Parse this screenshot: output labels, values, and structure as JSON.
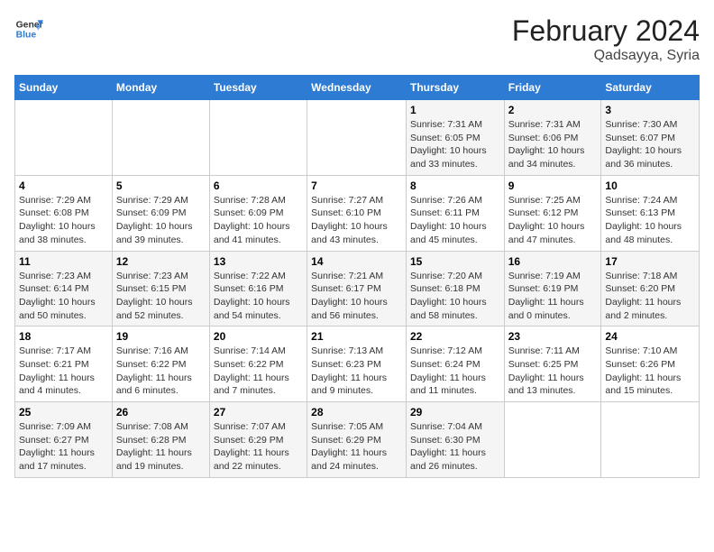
{
  "header": {
    "logo_line1": "General",
    "logo_line2": "Blue",
    "month": "February 2024",
    "location": "Qadsayya, Syria"
  },
  "weekdays": [
    "Sunday",
    "Monday",
    "Tuesday",
    "Wednesday",
    "Thursday",
    "Friday",
    "Saturday"
  ],
  "weeks": [
    [
      {
        "day": "",
        "info": ""
      },
      {
        "day": "",
        "info": ""
      },
      {
        "day": "",
        "info": ""
      },
      {
        "day": "",
        "info": ""
      },
      {
        "day": "1",
        "info": "Sunrise: 7:31 AM\nSunset: 6:05 PM\nDaylight: 10 hours and 33 minutes."
      },
      {
        "day": "2",
        "info": "Sunrise: 7:31 AM\nSunset: 6:06 PM\nDaylight: 10 hours and 34 minutes."
      },
      {
        "day": "3",
        "info": "Sunrise: 7:30 AM\nSunset: 6:07 PM\nDaylight: 10 hours and 36 minutes."
      }
    ],
    [
      {
        "day": "4",
        "info": "Sunrise: 7:29 AM\nSunset: 6:08 PM\nDaylight: 10 hours and 38 minutes."
      },
      {
        "day": "5",
        "info": "Sunrise: 7:29 AM\nSunset: 6:09 PM\nDaylight: 10 hours and 39 minutes."
      },
      {
        "day": "6",
        "info": "Sunrise: 7:28 AM\nSunset: 6:09 PM\nDaylight: 10 hours and 41 minutes."
      },
      {
        "day": "7",
        "info": "Sunrise: 7:27 AM\nSunset: 6:10 PM\nDaylight: 10 hours and 43 minutes."
      },
      {
        "day": "8",
        "info": "Sunrise: 7:26 AM\nSunset: 6:11 PM\nDaylight: 10 hours and 45 minutes."
      },
      {
        "day": "9",
        "info": "Sunrise: 7:25 AM\nSunset: 6:12 PM\nDaylight: 10 hours and 47 minutes."
      },
      {
        "day": "10",
        "info": "Sunrise: 7:24 AM\nSunset: 6:13 PM\nDaylight: 10 hours and 48 minutes."
      }
    ],
    [
      {
        "day": "11",
        "info": "Sunrise: 7:23 AM\nSunset: 6:14 PM\nDaylight: 10 hours and 50 minutes."
      },
      {
        "day": "12",
        "info": "Sunrise: 7:23 AM\nSunset: 6:15 PM\nDaylight: 10 hours and 52 minutes."
      },
      {
        "day": "13",
        "info": "Sunrise: 7:22 AM\nSunset: 6:16 PM\nDaylight: 10 hours and 54 minutes."
      },
      {
        "day": "14",
        "info": "Sunrise: 7:21 AM\nSunset: 6:17 PM\nDaylight: 10 hours and 56 minutes."
      },
      {
        "day": "15",
        "info": "Sunrise: 7:20 AM\nSunset: 6:18 PM\nDaylight: 10 hours and 58 minutes."
      },
      {
        "day": "16",
        "info": "Sunrise: 7:19 AM\nSunset: 6:19 PM\nDaylight: 11 hours and 0 minutes."
      },
      {
        "day": "17",
        "info": "Sunrise: 7:18 AM\nSunset: 6:20 PM\nDaylight: 11 hours and 2 minutes."
      }
    ],
    [
      {
        "day": "18",
        "info": "Sunrise: 7:17 AM\nSunset: 6:21 PM\nDaylight: 11 hours and 4 minutes."
      },
      {
        "day": "19",
        "info": "Sunrise: 7:16 AM\nSunset: 6:22 PM\nDaylight: 11 hours and 6 minutes."
      },
      {
        "day": "20",
        "info": "Sunrise: 7:14 AM\nSunset: 6:22 PM\nDaylight: 11 hours and 7 minutes."
      },
      {
        "day": "21",
        "info": "Sunrise: 7:13 AM\nSunset: 6:23 PM\nDaylight: 11 hours and 9 minutes."
      },
      {
        "day": "22",
        "info": "Sunrise: 7:12 AM\nSunset: 6:24 PM\nDaylight: 11 hours and 11 minutes."
      },
      {
        "day": "23",
        "info": "Sunrise: 7:11 AM\nSunset: 6:25 PM\nDaylight: 11 hours and 13 minutes."
      },
      {
        "day": "24",
        "info": "Sunrise: 7:10 AM\nSunset: 6:26 PM\nDaylight: 11 hours and 15 minutes."
      }
    ],
    [
      {
        "day": "25",
        "info": "Sunrise: 7:09 AM\nSunset: 6:27 PM\nDaylight: 11 hours and 17 minutes."
      },
      {
        "day": "26",
        "info": "Sunrise: 7:08 AM\nSunset: 6:28 PM\nDaylight: 11 hours and 19 minutes."
      },
      {
        "day": "27",
        "info": "Sunrise: 7:07 AM\nSunset: 6:29 PM\nDaylight: 11 hours and 22 minutes."
      },
      {
        "day": "28",
        "info": "Sunrise: 7:05 AM\nSunset: 6:29 PM\nDaylight: 11 hours and 24 minutes."
      },
      {
        "day": "29",
        "info": "Sunrise: 7:04 AM\nSunset: 6:30 PM\nDaylight: 11 hours and 26 minutes."
      },
      {
        "day": "",
        "info": ""
      },
      {
        "day": "",
        "info": ""
      }
    ]
  ]
}
